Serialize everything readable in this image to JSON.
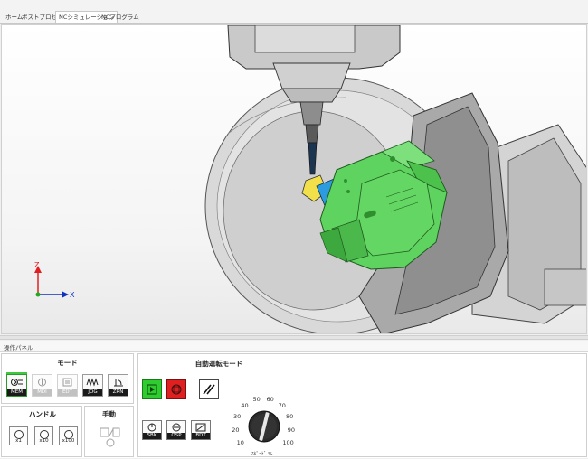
{
  "tabs": [
    {
      "label": "ホーム"
    },
    {
      "label": "ポストプロセッサ"
    },
    {
      "label": "NCシミュレーション",
      "active": true
    },
    {
      "label": "NCプログラム"
    }
  ],
  "viewport": {
    "axes": {
      "z": "Z",
      "x": "X"
    }
  },
  "panel": {
    "header": "操作パネル",
    "mode": {
      "title": "モード",
      "buttons": [
        {
          "label": "MEM",
          "icon": "mem-icon",
          "active": true
        },
        {
          "label": "MDI",
          "icon": "mdi-icon",
          "dim": true
        },
        {
          "label": "EDT",
          "icon": "edit-icon",
          "dim": true
        },
        {
          "label": "JOG",
          "icon": "jog-icon"
        },
        {
          "label": "ZRN",
          "icon": "zero-return-icon"
        }
      ]
    },
    "handle": {
      "title": "ハンドル",
      "buttons": [
        {
          "label": "x1"
        },
        {
          "label": "x10"
        },
        {
          "label": "x100"
        }
      ]
    },
    "manual": {
      "title": "手動"
    },
    "auto": {
      "title": "自動運転モード",
      "cycle_buttons": [
        {
          "name": "cycle-start",
          "color": "#2ecc2e"
        },
        {
          "name": "feed-hold",
          "color": "#e02020"
        }
      ],
      "option_buttons": [
        {
          "label": "SBK"
        },
        {
          "label": "OSP"
        },
        {
          "label": "BDT"
        }
      ],
      "dial": {
        "labels": [
          "10",
          "20",
          "30",
          "40",
          "50",
          "60",
          "70",
          "80",
          "90",
          "100"
        ],
        "caption": "ｽﾋﾟｰﾄﾞ %",
        "value": 60
      }
    }
  },
  "colors": {
    "fixture_green": "#5fd35f",
    "part_blue": "#2c9be0",
    "tool_yellow": "#f1e04a",
    "active_green": "#3ec93e"
  }
}
